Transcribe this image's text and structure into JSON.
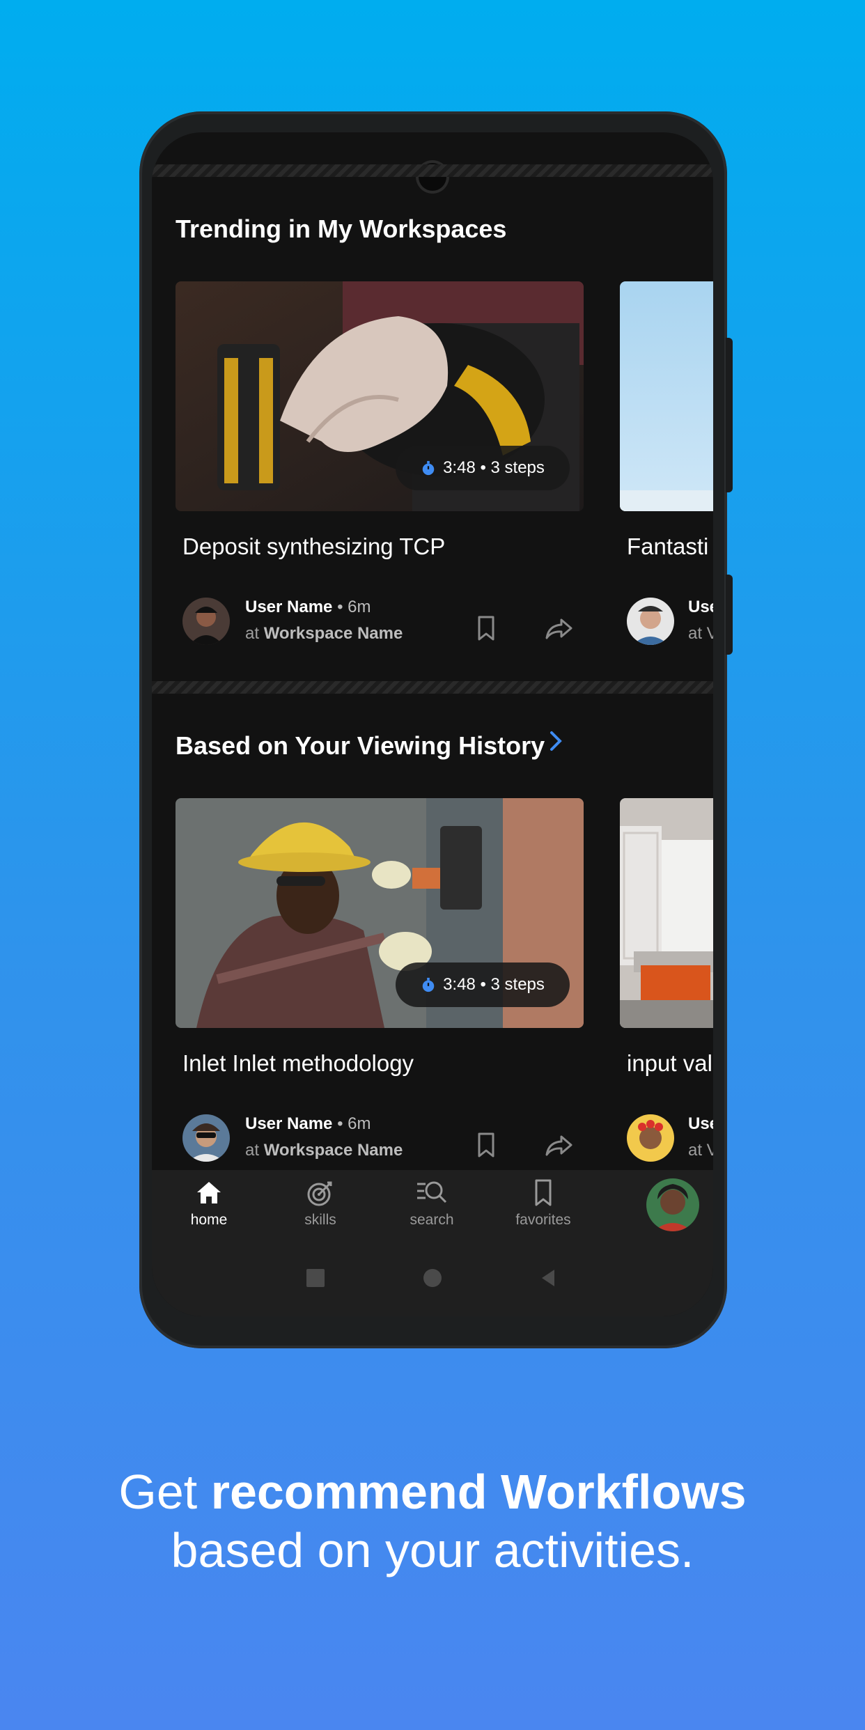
{
  "sections": [
    {
      "title": "Trending in My Workspaces",
      "has_chevron": false
    },
    {
      "title": "Based on Your Viewing History",
      "has_chevron": true
    }
  ],
  "cards": [
    {
      "badge": "3:48 • 3 steps",
      "title": "Deposit synthesizing TCP",
      "user": "User Name",
      "time": " • 6m",
      "at": "at ",
      "workspace": "Workspace Name"
    },
    {
      "badge": "3:48 • 3 steps",
      "title": "Inlet Inlet methodology",
      "user": "User Name",
      "time": " • 6m",
      "at": "at ",
      "workspace": "Workspace Name"
    }
  ],
  "peek_cards": [
    {
      "title": "Fantasti",
      "user": "Use",
      "meta": "at V"
    },
    {
      "title": "input val",
      "user": "Use",
      "meta": "at V"
    }
  ],
  "nav": {
    "home": "home",
    "skills": "skills",
    "search": "search",
    "favorites": "favorites"
  },
  "caption": {
    "line1_pre": "Get ",
    "line1_bold": "recommend Workflows",
    "line2": "based on your activities."
  },
  "colors": {
    "accent": "#3f8cf3",
    "screen_bg": "#121212",
    "nav_bg": "#1f1f1f"
  }
}
